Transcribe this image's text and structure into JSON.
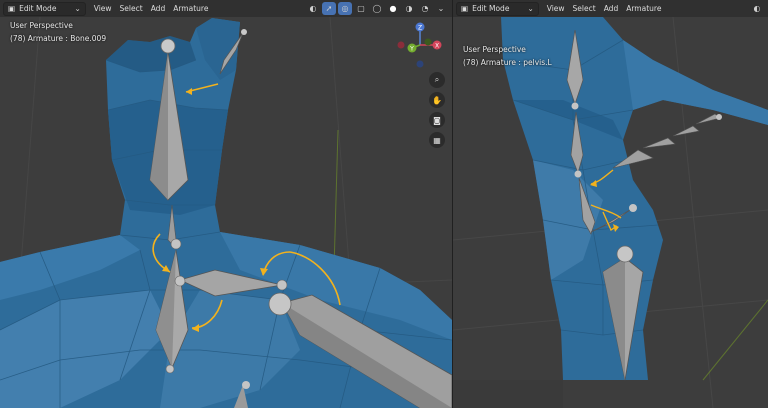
{
  "left_viewport": {
    "mode": "Edit Mode",
    "menus": [
      "View",
      "Select",
      "Add",
      "Armature"
    ],
    "perspective": "User Perspective",
    "info": "(78) Armature : Bone.009",
    "gizmo_axes": [
      "Z",
      "X",
      "Y"
    ],
    "nav_icons": [
      "zoom-icon",
      "hand-pan-icon",
      "camera-icon",
      "grid-icon"
    ],
    "header_icons": [
      "view-object-types-icon",
      "gizmo-icon",
      "overlay-icon",
      "xray-icon",
      "solid-shading-icon",
      "material-shading-icon",
      "rendered-shading-icon",
      "wireframe-icon"
    ]
  },
  "right_viewport": {
    "mode": "Edit Mode",
    "menus": [
      "View",
      "Select",
      "Add",
      "Armature"
    ],
    "perspective": "User Perspective",
    "info": "(78) Armature : pelvis.L",
    "header_icons": [
      "view-object-types-icon"
    ]
  },
  "colors": {
    "mesh": "#2e6c9a",
    "mesh_dark": "#1d4e74",
    "mesh_light": "#4b86b4",
    "bone": "#a3a3a3",
    "bone_dark": "#6b6b6b",
    "arrow": "#f2b21e",
    "background": "#3d3d3d",
    "header": "#303030",
    "accent": "#4772b3"
  }
}
